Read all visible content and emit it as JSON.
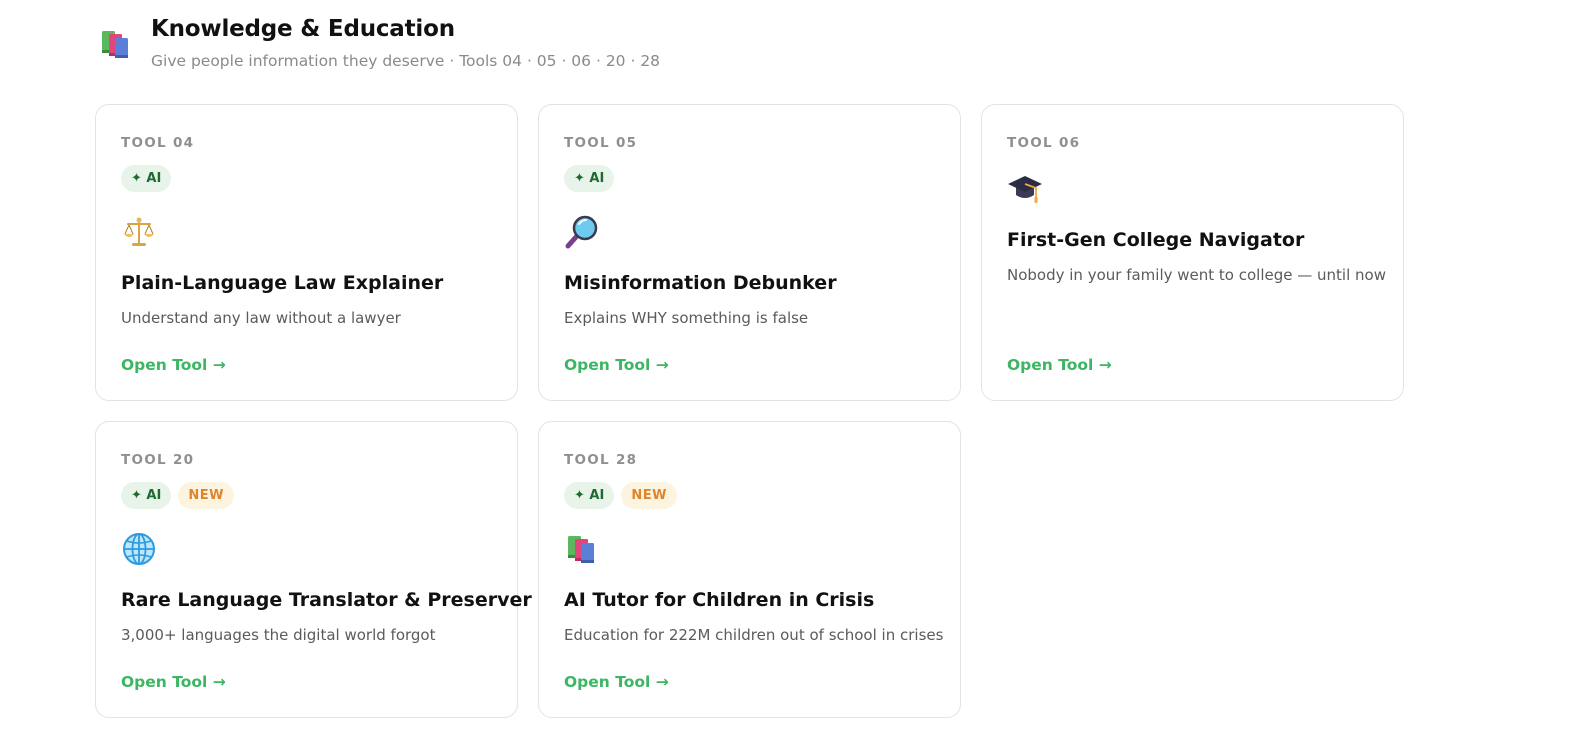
{
  "section": {
    "icon": "books-icon",
    "title": "Knowledge & Education",
    "subtitle": "Give people information they deserve · Tools 04 · 05 · 06 · 20 · 28"
  },
  "colors": {
    "accent_green": "#3cb663",
    "ai_badge_bg": "#e8f4ea",
    "ai_badge_text": "#1e6b30",
    "new_badge_bg": "#fdf4e0",
    "new_badge_text": "#e0842c"
  },
  "cards": [
    {
      "tool": "TOOL 04",
      "badges": [
        "✦ AI"
      ],
      "icon": "scales-icon",
      "title": "Plain-Language Law Explainer",
      "description": "Understand any law without a lawyer",
      "link": "Open Tool →"
    },
    {
      "tool": "TOOL 05",
      "badges": [
        "✦ AI"
      ],
      "icon": "magnifier-icon",
      "title": "Misinformation Debunker",
      "description": "Explains WHY something is false",
      "link": "Open Tool →"
    },
    {
      "tool": "TOOL 06",
      "badges": [],
      "icon": "graduation-cap-icon",
      "title": "First-Gen College Navigator",
      "description": "Nobody in your family went to college — until now",
      "link": "Open Tool →"
    },
    {
      "tool": "TOOL 20",
      "badges": [
        "✦ AI",
        "NEW"
      ],
      "icon": "globe-icon",
      "title": "Rare Language Translator & Preserver",
      "description": "3,000+ languages the digital world forgot",
      "link": "Open Tool →"
    },
    {
      "tool": "TOOL 28",
      "badges": [
        "✦ AI",
        "NEW"
      ],
      "icon": "books-icon",
      "title": "AI Tutor for Children in Crisis",
      "description": "Education for 222M children out of school in crises",
      "link": "Open Tool →"
    }
  ]
}
